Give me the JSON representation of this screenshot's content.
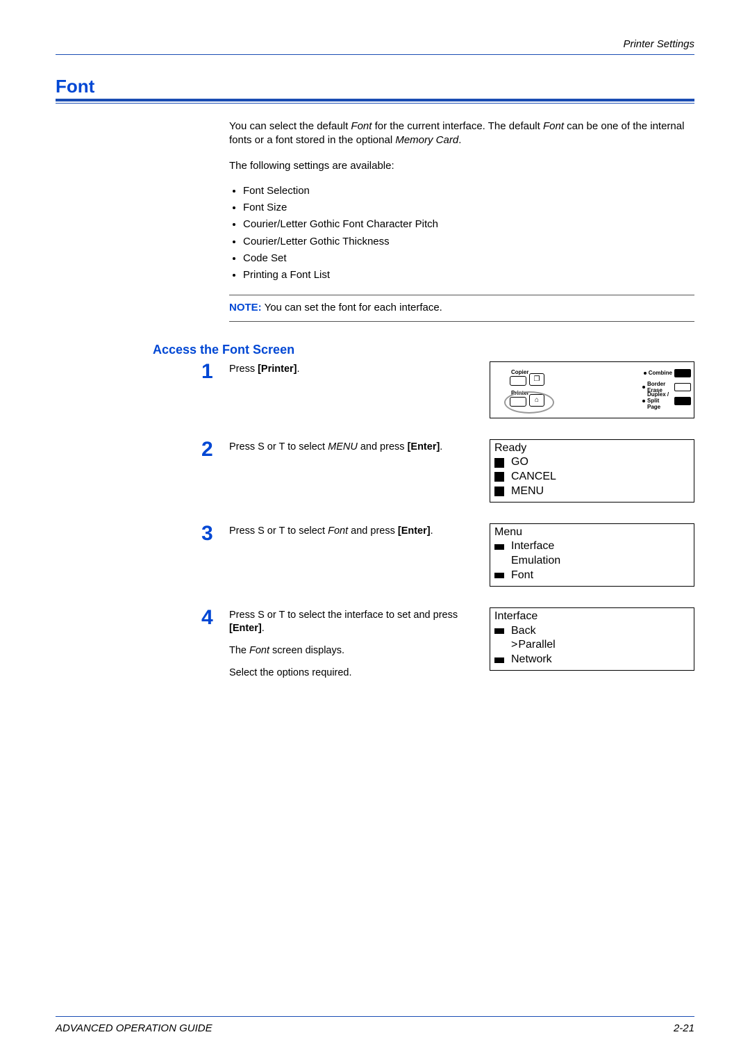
{
  "header": {
    "section": "Printer Settings"
  },
  "title": "Font",
  "intro": {
    "p1a": "You can select the default ",
    "p1b": "Font",
    "p1c": " for the current interface. The default ",
    "p1d": "Font",
    "p1e": " can be one of the internal fonts or a font stored in the optional ",
    "p1f": "Memory Card",
    "p1g": ".",
    "p2": "The following settings are available:"
  },
  "settings_list": [
    "Font Selection",
    "Font Size",
    "Courier/Letter Gothic Font Character Pitch",
    "Courier/Letter Gothic Thickness",
    "Code Set",
    "Printing a Font List"
  ],
  "note": {
    "label": "NOTE:",
    "text": " You can set the font for each interface."
  },
  "subheading": "Access the Font Screen",
  "panel": {
    "copier_label": "Copier",
    "printer_label": "Printer",
    "right_labels": [
      "Combine",
      "Border Erase",
      "Duplex / Split Page"
    ]
  },
  "steps": [
    {
      "num": "1",
      "text_a": "Press ",
      "bold_a": "[Printer]",
      "text_b": "."
    },
    {
      "num": "2",
      "text_a": "Press  S or  T to select ",
      "ital_a": "MENU",
      "text_b": " and press ",
      "bold_a": "[Enter]",
      "text_c": ".",
      "lcd": {
        "title": "Ready",
        "rows": [
          {
            "mark": "solid",
            "text": "GO"
          },
          {
            "mark": "solid",
            "text": "CANCEL"
          },
          {
            "mark": "solid",
            "text": "MENU"
          }
        ]
      }
    },
    {
      "num": "3",
      "text_a": "Press  S or  T to select ",
      "ital_a": "Font",
      "text_b": " and press ",
      "bold_a": "[Enter]",
      "text_c": ".",
      "lcd": {
        "title": "Menu",
        "rows": [
          {
            "mark": "small",
            "text": "Interface"
          },
          {
            "mark": "blank",
            "text": "Emulation"
          },
          {
            "mark": "small",
            "text": "Font"
          }
        ]
      }
    },
    {
      "num": "4",
      "text_a": "Press  S or  T to select the interface to set and press ",
      "bold_a": "[Enter]",
      "text_b": ".",
      "p2a": "The ",
      "p2i": "Font",
      "p2b": " screen displays.",
      "p3": "Select the options required.",
      "lcd": {
        "title": "Interface",
        "rows": [
          {
            "mark": "small",
            "text": "Back"
          },
          {
            "mark": "blank",
            "text": "Parallel",
            "selected": true
          },
          {
            "mark": "small",
            "text": "Network"
          }
        ]
      }
    }
  ],
  "footer": {
    "left": "ADVANCED OPERATION GUIDE",
    "right": "2-21"
  }
}
